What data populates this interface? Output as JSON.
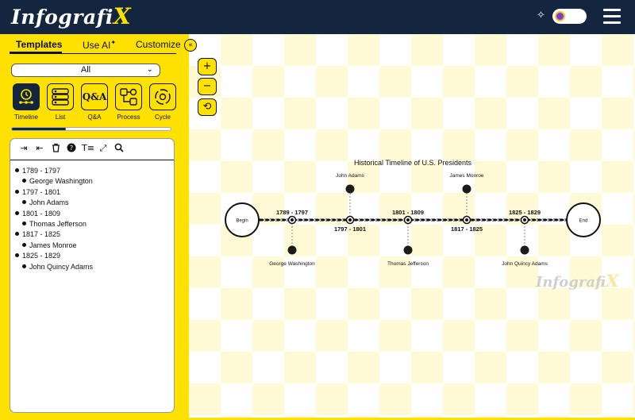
{
  "app": {
    "logo_text": "Infografi",
    "logo_x": "X",
    "accent": "#ffe100",
    "navy": "#13253f"
  },
  "tabs": [
    {
      "label": "Templates"
    },
    {
      "label": "Use AI"
    },
    {
      "label": "Customize"
    }
  ],
  "filter": {
    "value": "All"
  },
  "template_types": [
    {
      "label": "Timeline",
      "icon": "clock-timeline-icon"
    },
    {
      "label": "List",
      "icon": "list-icon"
    },
    {
      "label": "Q&A",
      "icon": "qa-icon"
    },
    {
      "label": "Process",
      "icon": "process-icon"
    },
    {
      "label": "Cycle",
      "icon": "cycle-icon"
    }
  ],
  "carousel_progress": 0.34,
  "outline": [
    {
      "period": "1789 - 1797",
      "name": "George Washington"
    },
    {
      "period": "1797 - 1801",
      "name": "John Adams"
    },
    {
      "period": "1801 - 1809",
      "name": "Thomas Jefferson"
    },
    {
      "period": "1817 - 1825",
      "name": "James Monroe"
    },
    {
      "period": "1825 - 1829",
      "name": "John Quincy Adams"
    }
  ],
  "zoom": {
    "in": "+",
    "out": "−",
    "reset": "⟲"
  },
  "diagram": {
    "title": "Historical Timeline of U.S. Presidents",
    "begin": "Begin",
    "end": "End",
    "events": [
      {
        "period": "1789 - 1797",
        "name": "George Washington"
      },
      {
        "period": "1797 - 1801",
        "name": "John Adams"
      },
      {
        "period": "1801 - 1809",
        "name": "Thomas Jefferson"
      },
      {
        "period": "1817 - 1825",
        "name": "James Monroe"
      },
      {
        "period": "1825 - 1829",
        "name": "John Quincy Adams"
      }
    ]
  },
  "watermark": {
    "text": "Infografi",
    "x": "X"
  }
}
